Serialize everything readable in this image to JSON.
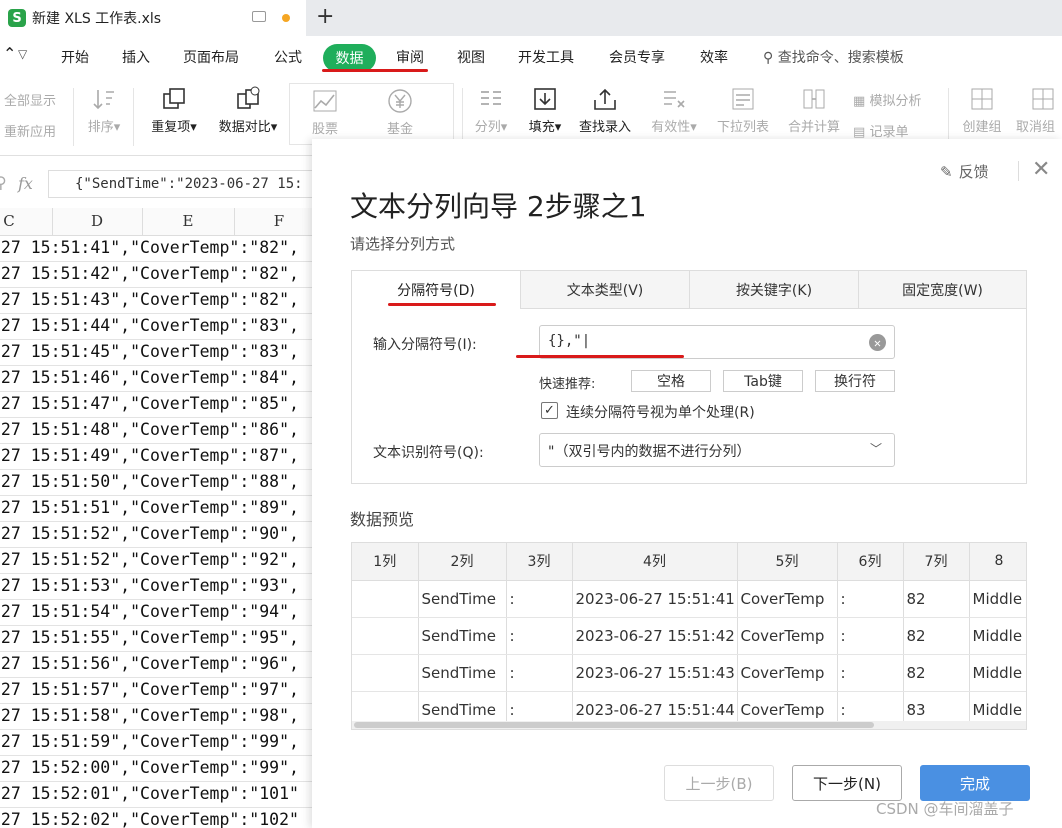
{
  "window": {
    "tab_title": "新建 XLS 工作表.xls",
    "app_logo_letter": "S"
  },
  "menu": {
    "items": [
      "开始",
      "插入",
      "页面布局",
      "公式",
      "数据",
      "审阅",
      "视图",
      "开发工具",
      "会员专享",
      "效率"
    ],
    "active": "数据",
    "search_placeholder": "查找命令、搜索模板"
  },
  "ribbon": {
    "show_all": "全部显示",
    "reapply": "重新应用",
    "sort": "排序",
    "duplicates": "重复项",
    "compare": "数据对比",
    "stocks": "股票",
    "funds": "基金",
    "split": "分列",
    "fill": "填充",
    "find_input": "查找录入",
    "validity": "有效性",
    "dropdown": "下拉列表",
    "merge_calc": "合并计算",
    "simulate": "模拟分析",
    "record_form": "记录单",
    "create_group": "创建组",
    "ungroup": "取消组"
  },
  "formula_bar": {
    "content": "{\"SendTime\":\"2023-06-27 15:"
  },
  "sheet": {
    "columns": [
      "C",
      "D",
      "E",
      "F"
    ],
    "rows": [
      "-27 15:51:41\",\"CoverTemp\":\"82\",",
      "-27 15:51:42\",\"CoverTemp\":\"82\",",
      "-27 15:51:43\",\"CoverTemp\":\"82\",",
      "-27 15:51:44\",\"CoverTemp\":\"83\",",
      "-27 15:51:45\",\"CoverTemp\":\"83\",",
      "-27 15:51:46\",\"CoverTemp\":\"84\",",
      "-27 15:51:47\",\"CoverTemp\":\"85\",",
      "-27 15:51:48\",\"CoverTemp\":\"86\",",
      "-27 15:51:49\",\"CoverTemp\":\"87\",",
      "-27 15:51:50\",\"CoverTemp\":\"88\",",
      "-27 15:51:51\",\"CoverTemp\":\"89\",",
      "-27 15:51:52\",\"CoverTemp\":\"90\",",
      "-27 15:51:52\",\"CoverTemp\":\"92\",",
      "-27 15:51:53\",\"CoverTemp\":\"93\",",
      "-27 15:51:54\",\"CoverTemp\":\"94\",",
      "-27 15:51:55\",\"CoverTemp\":\"95\",",
      "-27 15:51:56\",\"CoverTemp\":\"96\",",
      "-27 15:51:57\",\"CoverTemp\":\"97\",",
      "-27 15:51:58\",\"CoverTemp\":\"98\",",
      "-27 15:51:59\",\"CoverTemp\":\"99\",",
      "-27 15:52:00\",\"CoverTemp\":\"99\",",
      "-27 15:52:01\",\"CoverTemp\":\"101\"",
      "-27 15:52:02\",\"CoverTemp\":\"102\""
    ]
  },
  "dialog": {
    "feedback": "反馈",
    "title": "文本分列向导 2步骤之1",
    "subtitle": "请选择分列方式",
    "tabs": [
      "分隔符号(D)",
      "文本类型(V)",
      "按关键字(K)",
      "固定宽度(W)"
    ],
    "delimiter_label": "输入分隔符号(I):",
    "delimiter_value": "{},\"|",
    "quick_label": "快速推荐:",
    "quick_buttons": [
      "空格",
      "Tab键",
      "换行符"
    ],
    "consecutive_label": "连续分隔符号视为单个处理(R)",
    "consecutive_checked": true,
    "qualifier_label": "文本识别符号(Q):",
    "qualifier_value": "\"（双引号内的数据不进行分列）",
    "preview_label": "数据预览",
    "preview_headers": [
      "1列",
      "2列",
      "3列",
      "4列",
      "5列",
      "6列",
      "7列",
      "8"
    ],
    "preview_rows": [
      [
        "",
        "SendTime",
        ":",
        "2023-06-27 15:51:41",
        "CoverTemp",
        ":",
        "82",
        "Middle"
      ],
      [
        "",
        "SendTime",
        ":",
        "2023-06-27 15:51:42",
        "CoverTemp",
        ":",
        "82",
        "Middle"
      ],
      [
        "",
        "SendTime",
        ":",
        "2023-06-27 15:51:43",
        "CoverTemp",
        ":",
        "82",
        "Middle"
      ],
      [
        "",
        "SendTime",
        ":",
        "2023-06-27 15:51:44",
        "CoverTemp",
        ":",
        "83",
        "Middle"
      ]
    ],
    "prev_button": "上一步(B)",
    "next_button": "下一步(N)",
    "finish_button": "完成"
  },
  "watermark": "CSDN @车间溜盖子",
  "colors": {
    "accent_green": "#1fae5b",
    "primary_blue": "#4a90e2",
    "annotation_red": "#d91a1a"
  }
}
